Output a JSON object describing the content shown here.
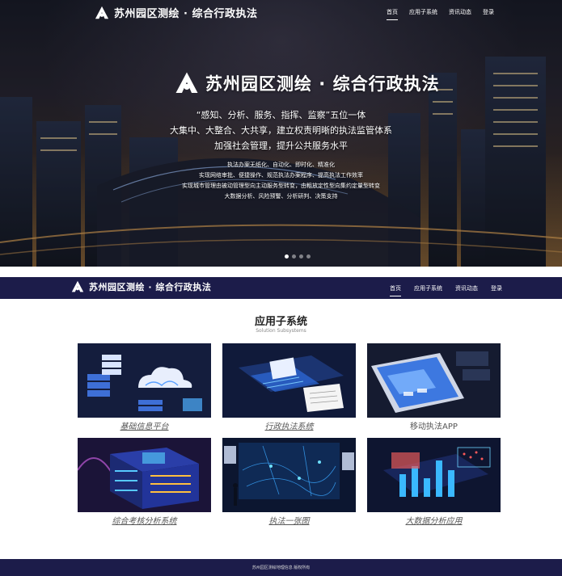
{
  "brand": {
    "name": "苏州园区测绘 · 综合行政执法"
  },
  "nav": {
    "items": [
      "首页",
      "应用子系统",
      "资讯动态",
      "登录"
    ],
    "active": 0
  },
  "hero": {
    "title": "苏州园区测绘 · 综合行政执法",
    "line1": "“感知、分析、服务、指挥、监察”五位一体",
    "line2": "大集中、大整合、大共享，建立权责明晰的执法监管体系",
    "line3": "加强社会管理，提升公共服务水平",
    "small": [
      "执法办案无纸化、自动化、即时化、精准化",
      "实现网络审批、便捷操作、规范执法办案程序、提高执法工作效率",
      "实现城市管理由被动管理型向主动服务型转变，由粗放定性型向集约定量型转变",
      "大数据分析、风险预警、分析研判、决策支持"
    ],
    "slide_count": 4,
    "slide_active": 0
  },
  "section": {
    "title": "应用子系统",
    "subtitle": "Solution Subsystems"
  },
  "cards": [
    {
      "label": "基础信息平台",
      "icon": "cloud-server-icon"
    },
    {
      "label": "行政执法系统",
      "icon": "documents-icon"
    },
    {
      "label": "移动执法APP",
      "icon": "mobile-icon"
    },
    {
      "label": "综合考核分析系统",
      "icon": "server-rack-icon"
    },
    {
      "label": "执法一张图",
      "icon": "map-screen-icon"
    },
    {
      "label": "大数据分析应用",
      "icon": "data-bars-icon"
    }
  ],
  "footer": {
    "text": "苏州园区测绘地理信息 版权所有"
  }
}
